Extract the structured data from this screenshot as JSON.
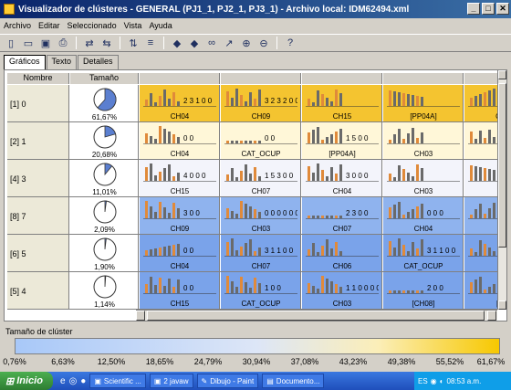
{
  "window": {
    "title": "Visualizador de clústeres - GENERAL (PJ1_1, PJ2_1, PJ3_1) - Archivo local: IDM62494.xml",
    "minimize": "_",
    "maximize": "□",
    "close": "✕"
  },
  "menu": [
    "Archivo",
    "Editar",
    "Seleccionado",
    "Vista",
    "Ayuda"
  ],
  "toolbar": [
    "new-icon",
    "open-icon",
    "save-icon",
    "print-icon",
    "undo-icon",
    "redo-icon",
    "sort-icon",
    "filter-icon",
    "prev-icon",
    "next-icon",
    "binoculars-icon",
    "pointer-icon",
    "zoom-in-icon",
    "zoom-out-icon",
    "help-icon"
  ],
  "tabs": [
    "Gráficos",
    "Texto",
    "Detalles"
  ],
  "table": {
    "headers": [
      "Nombre",
      "Tamaño"
    ],
    "rows": [
      {
        "name": "[1] 0",
        "size": "61,67%",
        "fraction": 0.6167,
        "bg": "#f4c430",
        "cells": [
          {
            "label": "CH04",
            "text": "2 3 1 0 0"
          },
          {
            "label": "CH09",
            "text": "3 2 3 2 0 0"
          },
          {
            "label": "CH15",
            "text": ""
          },
          {
            "label": "[PP04A]",
            "text": ""
          },
          {
            "label": "CAT_",
            "text": ""
          }
        ]
      },
      {
        "name": "[2] 1",
        "size": "20,68%",
        "fraction": 0.2068,
        "bg": "#fff7d8",
        "cells": [
          {
            "label": "CH04",
            "text": "0 0"
          },
          {
            "label": "CAT_OCUP",
            "text": "0 0"
          },
          {
            "label": "[PP04A]",
            "text": "1 5 0 0"
          },
          {
            "label": "CH03",
            "text": ""
          },
          {
            "label": "[P",
            "text": ""
          }
        ]
      },
      {
        "name": "[4] 3",
        "size": "11,01%",
        "fraction": 0.1101,
        "bg": "#f3f4fb",
        "cells": [
          {
            "label": "CH15",
            "text": "4 0 0 0"
          },
          {
            "label": "CH07",
            "text": "1 5 3 0 0"
          },
          {
            "label": "CH04",
            "text": "3 0 0 0"
          },
          {
            "label": "CH03",
            "text": ""
          },
          {
            "label": "[PP",
            "text": ""
          }
        ]
      },
      {
        "name": "[8] 7",
        "size": "2,09%",
        "fraction": 0.0209,
        "bg": "#8fb3ee",
        "cells": [
          {
            "label": "CH09",
            "text": "3 0 0"
          },
          {
            "label": "CH03",
            "text": "0 0 0 0 0 0 0 0"
          },
          {
            "label": "CH07",
            "text": "2 3 0 0"
          },
          {
            "label": "CH04",
            "text": "0 0 0"
          },
          {
            "label": "",
            "text": ""
          }
        ]
      },
      {
        "name": "[6] 5",
        "size": "1,90%",
        "fraction": 0.019,
        "bg": "#7aa3ea",
        "cells": [
          {
            "label": "CH04",
            "text": "0 0"
          },
          {
            "label": "CH07",
            "text": "3 1 1 0 0"
          },
          {
            "label": "CH06",
            "text": ""
          },
          {
            "label": "CAT_OCUP",
            "text": "3 1 1 0 0"
          },
          {
            "label": "",
            "text": ""
          }
        ]
      },
      {
        "name": "[5] 4",
        "size": "1,14%",
        "fraction": 0.0114,
        "bg": "#7aa3ea",
        "cells": [
          {
            "label": "CH15",
            "text": "0 0"
          },
          {
            "label": "CAT_OCUP",
            "text": "1 0 0"
          },
          {
            "label": "CH03",
            "text": "1 1 0 0 0 0 0"
          },
          {
            "label": "[CH08]",
            "text": "2 0 0"
          },
          {
            "label": "[TOT",
            "text": ""
          }
        ]
      }
    ]
  },
  "legend": {
    "title": "Tamaño de clúster",
    "ticks": [
      "0,76%",
      "6,63%",
      "12,50%",
      "18,65%",
      "24,79%",
      "30,94%",
      "37,08%",
      "43,23%",
      "49,38%",
      "55,52%",
      "61,67%"
    ]
  },
  "taskbar": {
    "start": "Inicio",
    "tasks": [
      "Scientific ...",
      "2 javaw",
      "Dibujo - Paint",
      "Documento..."
    ],
    "tray": "ES",
    "clock": "08:53 a.m."
  }
}
